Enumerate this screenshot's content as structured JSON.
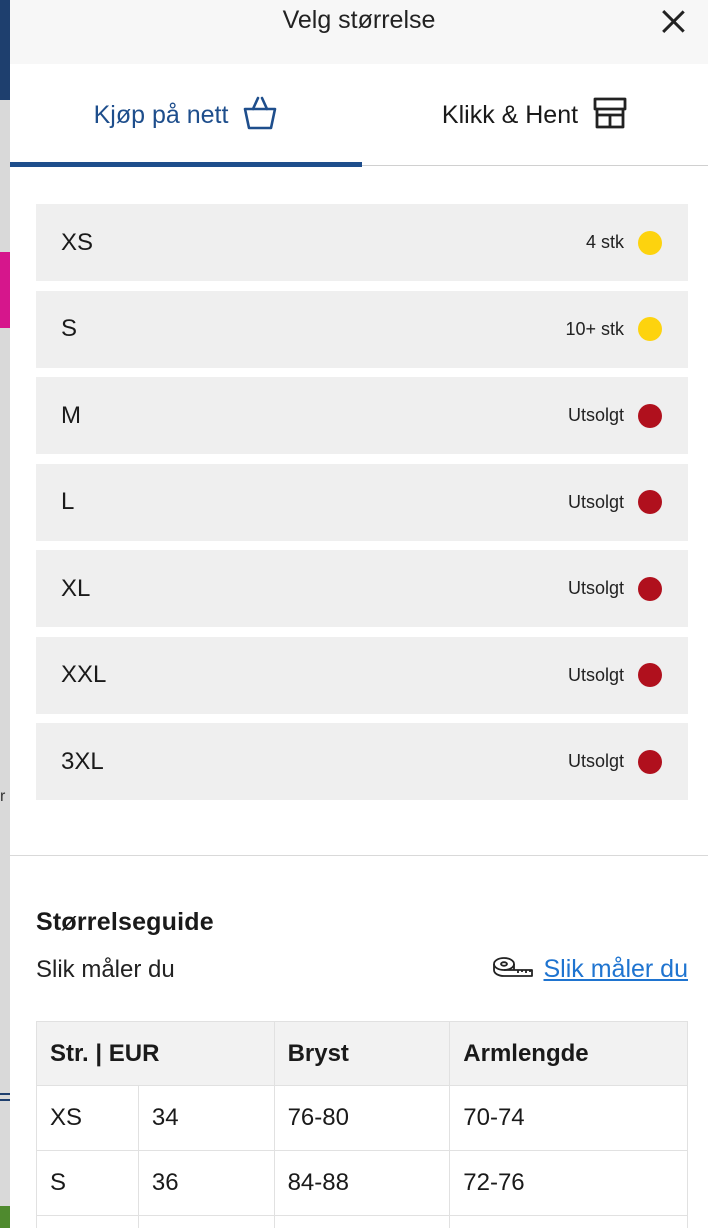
{
  "header": {
    "title": "Velg størrelse"
  },
  "tabs": [
    {
      "label": "Kjøp på nett",
      "icon": "shopping-basket-icon",
      "active": true
    },
    {
      "label": "Klikk & Hent",
      "icon": "store-icon",
      "active": false
    }
  ],
  "sizes": [
    {
      "size": "XS",
      "stock": "4 stk",
      "status_color": "#fdd30e"
    },
    {
      "size": "S",
      "stock": "10+ stk",
      "status_color": "#fdd30e"
    },
    {
      "size": "M",
      "stock": "Utsolgt",
      "status_color": "#b0101d"
    },
    {
      "size": "L",
      "stock": "Utsolgt",
      "status_color": "#b0101d"
    },
    {
      "size": "XL",
      "stock": "Utsolgt",
      "status_color": "#b0101d"
    },
    {
      "size": "XXL",
      "stock": "Utsolgt",
      "status_color": "#b0101d"
    },
    {
      "size": "3XL",
      "stock": "Utsolgt",
      "status_color": "#b0101d"
    }
  ],
  "guide": {
    "title": "Størrelseguide",
    "subtitle": "Slik måler du",
    "link_label": "Slik måler du",
    "link_icon": "measuring-tape-icon",
    "columns": [
      "Str. | EUR",
      "Bryst",
      "Armlengde"
    ],
    "rows": [
      [
        "XS",
        "34",
        "76-80",
        "70-74"
      ],
      [
        "S",
        "36",
        "84-88",
        "72-76"
      ]
    ]
  },
  "background": {
    "edge_text": "r"
  },
  "colors": {
    "accent": "#1e4e8c",
    "link": "#1f74d0",
    "low_stock": "#fdd30e",
    "sold_out": "#b0101d"
  }
}
